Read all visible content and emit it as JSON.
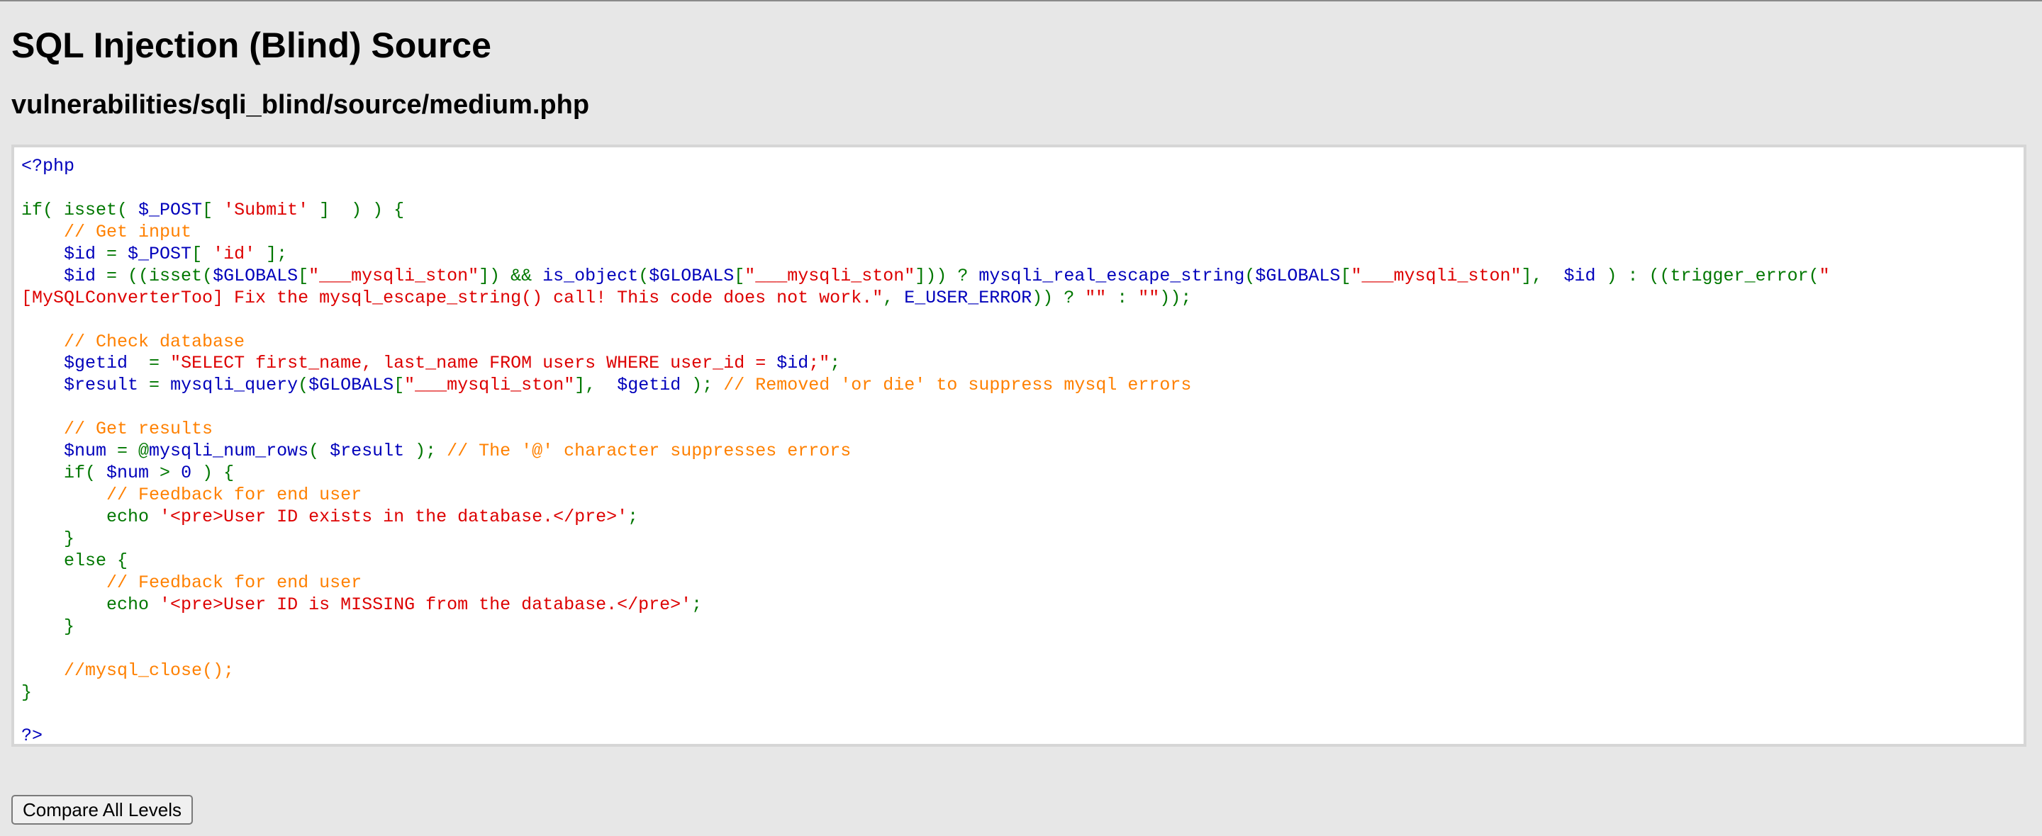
{
  "page": {
    "title": "SQL Injection (Blind) Source",
    "file_path": "vulnerabilities/sqli_blind/source/medium.php"
  },
  "code": {
    "lines": [
      [
        [
          "d",
          "<?php"
        ]
      ],
      [],
      [
        [
          "k",
          "if( isset( "
        ],
        [
          "d",
          "$_POST"
        ],
        [
          "k",
          "[ "
        ],
        [
          "s",
          "'Submit'"
        ],
        [
          "k",
          " ]  ) ) {"
        ]
      ],
      [
        [
          "k",
          "    "
        ],
        [
          "c",
          "// Get input"
        ]
      ],
      [
        [
          "k",
          "    "
        ],
        [
          "d",
          "$id "
        ],
        [
          "k",
          "= "
        ],
        [
          "d",
          "$_POST"
        ],
        [
          "k",
          "[ "
        ],
        [
          "s",
          "'id'"
        ],
        [
          "k",
          " ];"
        ]
      ],
      [
        [
          "k",
          "    "
        ],
        [
          "d",
          "$id "
        ],
        [
          "k",
          "= ((isset("
        ],
        [
          "d",
          "$GLOBALS"
        ],
        [
          "k",
          "["
        ],
        [
          "s",
          "\"___mysqli_ston\""
        ],
        [
          "k",
          "]) && "
        ],
        [
          "d",
          "is_object"
        ],
        [
          "k",
          "("
        ],
        [
          "d",
          "$GLOBALS"
        ],
        [
          "k",
          "["
        ],
        [
          "s",
          "\"___mysqli_ston\""
        ],
        [
          "k",
          "])) ? "
        ],
        [
          "d",
          "mysqli_real_escape_string"
        ],
        [
          "k",
          "("
        ],
        [
          "d",
          "$GLOBALS"
        ],
        [
          "k",
          "["
        ],
        [
          "s",
          "\"___mysqli_ston\""
        ],
        [
          "k",
          "],  "
        ],
        [
          "d",
          "$id "
        ],
        [
          "k",
          ") : ((trigger_error("
        ],
        [
          "s",
          "\""
        ]
      ],
      [
        [
          "s",
          "[MySQLConverterToo] Fix the mysql_escape_string() call! This code does not work.\""
        ],
        [
          "k",
          ", "
        ],
        [
          "d",
          "E_USER_ERROR"
        ],
        [
          "k",
          ")) ? "
        ],
        [
          "s",
          "\"\""
        ],
        [
          "k",
          " : "
        ],
        [
          "s",
          "\"\""
        ],
        [
          "k",
          "));"
        ]
      ],
      [],
      [
        [
          "k",
          "    "
        ],
        [
          "c",
          "// Check database"
        ]
      ],
      [
        [
          "k",
          "    "
        ],
        [
          "d",
          "$getid  "
        ],
        [
          "k",
          "= "
        ],
        [
          "s",
          "\"SELECT first_name, last_name FROM users WHERE user_id = "
        ],
        [
          "d",
          "$id"
        ],
        [
          "s",
          ";\""
        ],
        [
          "k",
          ";"
        ]
      ],
      [
        [
          "k",
          "    "
        ],
        [
          "d",
          "$result "
        ],
        [
          "k",
          "= "
        ],
        [
          "d",
          "mysqli_query"
        ],
        [
          "k",
          "("
        ],
        [
          "d",
          "$GLOBALS"
        ],
        [
          "k",
          "["
        ],
        [
          "s",
          "\"___mysqli_ston\""
        ],
        [
          "k",
          "],  "
        ],
        [
          "d",
          "$getid "
        ],
        [
          "k",
          "); "
        ],
        [
          "c",
          "// Removed 'or die' to suppress mysql errors"
        ]
      ],
      [],
      [
        [
          "k",
          "    "
        ],
        [
          "c",
          "// Get results"
        ]
      ],
      [
        [
          "k",
          "    "
        ],
        [
          "d",
          "$num "
        ],
        [
          "k",
          "= @"
        ],
        [
          "d",
          "mysqli_num_rows"
        ],
        [
          "k",
          "( "
        ],
        [
          "d",
          "$result "
        ],
        [
          "k",
          "); "
        ],
        [
          "c",
          "// The '@' character suppresses errors"
        ]
      ],
      [
        [
          "k",
          "    if( "
        ],
        [
          "d",
          "$num "
        ],
        [
          "k",
          "> "
        ],
        [
          "d",
          "0 "
        ],
        [
          "k",
          ") {"
        ]
      ],
      [
        [
          "k",
          "        "
        ],
        [
          "c",
          "// Feedback for end user"
        ]
      ],
      [
        [
          "k",
          "        echo "
        ],
        [
          "s",
          "'<pre>User ID exists in the database.</pre>'"
        ],
        [
          "k",
          ";"
        ]
      ],
      [
        [
          "k",
          "    }"
        ]
      ],
      [
        [
          "k",
          "    else {"
        ]
      ],
      [
        [
          "k",
          "        "
        ],
        [
          "c",
          "// Feedback for end user"
        ]
      ],
      [
        [
          "k",
          "        echo "
        ],
        [
          "s",
          "'<pre>User ID is MISSING from the database.</pre>'"
        ],
        [
          "k",
          ";"
        ]
      ],
      [
        [
          "k",
          "    }"
        ]
      ],
      [],
      [
        [
          "k",
          "    "
        ],
        [
          "c",
          "//mysql_close();"
        ]
      ],
      [
        [
          "k",
          "}"
        ]
      ],
      [],
      [
        [
          "d",
          "?>"
        ]
      ]
    ]
  },
  "actions": {
    "compare_label": "Compare All Levels"
  },
  "colors": {
    "default": "#0000bb",
    "keyword": "#007700",
    "string": "#dd0000",
    "comment": "#ff8000",
    "background": "#e7e7e7"
  }
}
